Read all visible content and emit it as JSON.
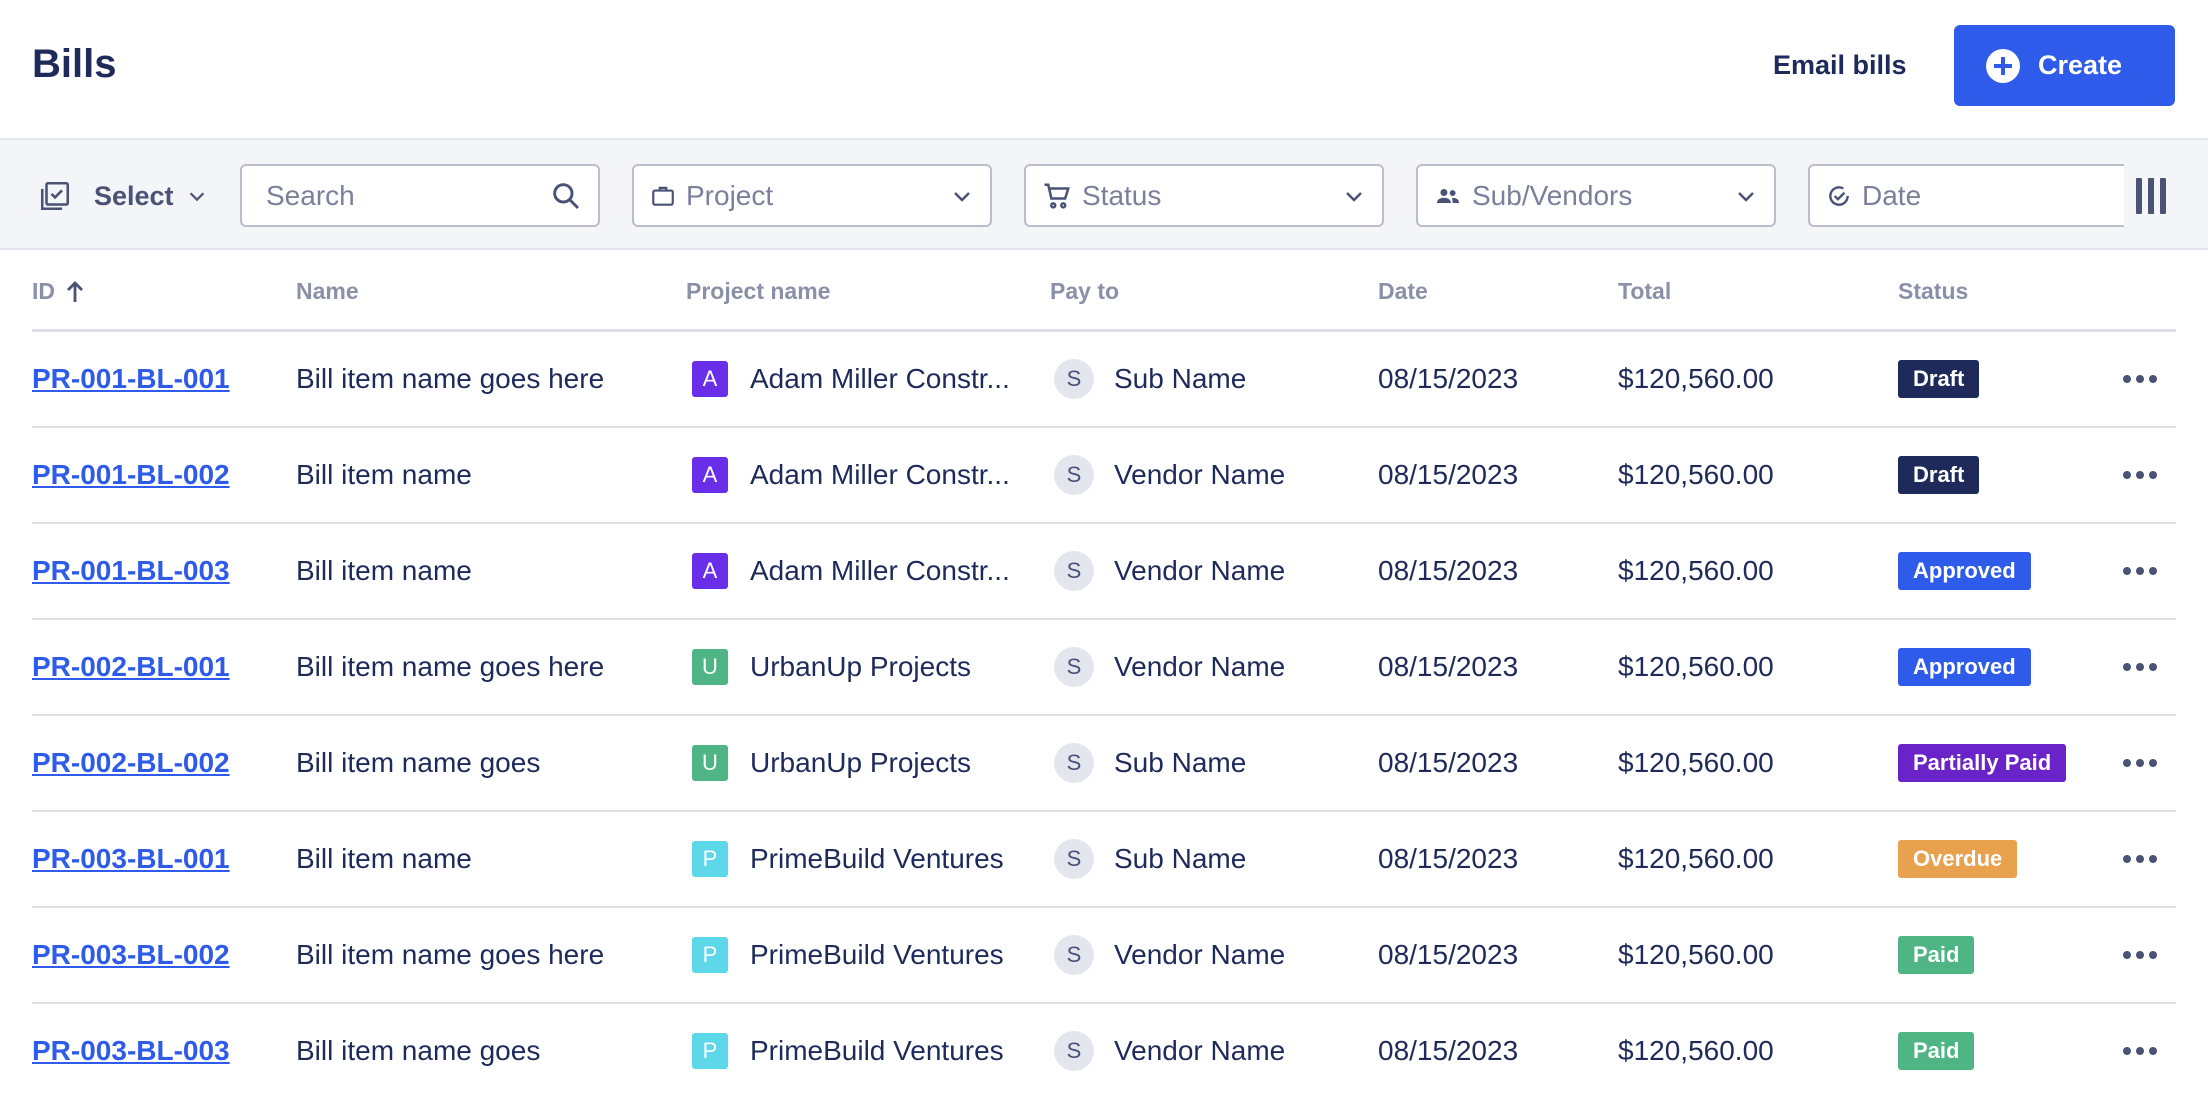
{
  "header": {
    "title": "Bills",
    "email_label": "Email bills",
    "create_label": "Create"
  },
  "toolbar": {
    "select_label": "Select",
    "search_placeholder": "Search",
    "project_label": "Project",
    "status_label": "Status",
    "sub_vendors_label": "Sub/Vendors",
    "date_label": "Date"
  },
  "table": {
    "columns": [
      "ID",
      "Name",
      "Project name",
      "Pay to",
      "Date",
      "Total",
      "Status"
    ],
    "rows": [
      {
        "id": "PR-001-BL-001",
        "name": "Bill item name goes here",
        "project": "Adam Miller Constr...",
        "project_initial": "A",
        "project_color": "#6a2ee8",
        "pay_initial": "S",
        "pay_to": "Sub Name",
        "date": "08/15/2023",
        "total": "$120,560.00",
        "status": "Draft",
        "status_color": "#1e2a5a"
      },
      {
        "id": "PR-001-BL-002",
        "name": "Bill item name",
        "project": "Adam Miller Constr...",
        "project_initial": "A",
        "project_color": "#6a2ee8",
        "pay_initial": "S",
        "pay_to": "Vendor Name",
        "date": "08/15/2023",
        "total": "$120,560.00",
        "status": "Draft",
        "status_color": "#1e2a5a"
      },
      {
        "id": "PR-001-BL-003",
        "name": "Bill item name",
        "project": "Adam Miller Constr...",
        "project_initial": "A",
        "project_color": "#6a2ee8",
        "pay_initial": "S",
        "pay_to": "Vendor Name",
        "date": "08/15/2023",
        "total": "$120,560.00",
        "status": "Approved",
        "status_color": "#2f5bea"
      },
      {
        "id": "PR-002-BL-001",
        "name": "Bill item name goes here",
        "project": "UrbanUp Projects",
        "project_initial": "U",
        "project_color": "#4fb584",
        "pay_initial": "S",
        "pay_to": "Vendor Name",
        "date": "08/15/2023",
        "total": "$120,560.00",
        "status": "Approved",
        "status_color": "#2f5bea"
      },
      {
        "id": "PR-002-BL-002",
        "name": "Bill item name goes",
        "project": "UrbanUp Projects",
        "project_initial": "U",
        "project_color": "#4fb584",
        "pay_initial": "S",
        "pay_to": "Sub Name",
        "date": "08/15/2023",
        "total": "$120,560.00",
        "status": "Partially Paid",
        "status_color": "#6a22c9"
      },
      {
        "id": "PR-003-BL-001",
        "name": "Bill item name",
        "project": "PrimeBuild Ventures",
        "project_initial": "P",
        "project_color": "#5dd8ea",
        "pay_initial": "S",
        "pay_to": "Sub Name",
        "date": "08/15/2023",
        "total": "$120,560.00",
        "status": "Overdue",
        "status_color": "#e8a24e"
      },
      {
        "id": "PR-003-BL-002",
        "name": "Bill item name goes here",
        "project": "PrimeBuild Ventures",
        "project_initial": "P",
        "project_color": "#5dd8ea",
        "pay_initial": "S",
        "pay_to": "Vendor Name",
        "date": "08/15/2023",
        "total": "$120,560.00",
        "status": "Paid",
        "status_color": "#4fb584"
      },
      {
        "id": "PR-003-BL-003",
        "name": "Bill item name goes",
        "project": "PrimeBuild Ventures",
        "project_initial": "P",
        "project_color": "#5dd8ea",
        "pay_initial": "S",
        "pay_to": "Vendor Name",
        "date": "08/15/2023",
        "total": "$120,560.00",
        "status": "Paid",
        "status_color": "#4fb584"
      }
    ]
  },
  "colors": {
    "accent": "#2f5bea",
    "text": "#1e2a5a",
    "muted": "#8a90a8",
    "toolbar_bg": "#f4f5f9"
  },
  "icons": {
    "select": "checklist-icon",
    "search": "search-icon",
    "project": "briefcase-icon",
    "status": "cart-icon",
    "sub_vendors": "people-icon",
    "date": "check-circle-icon",
    "columns": "columns-icon",
    "sort": "arrow-up-icon",
    "more": "more-horizontal-icon"
  }
}
